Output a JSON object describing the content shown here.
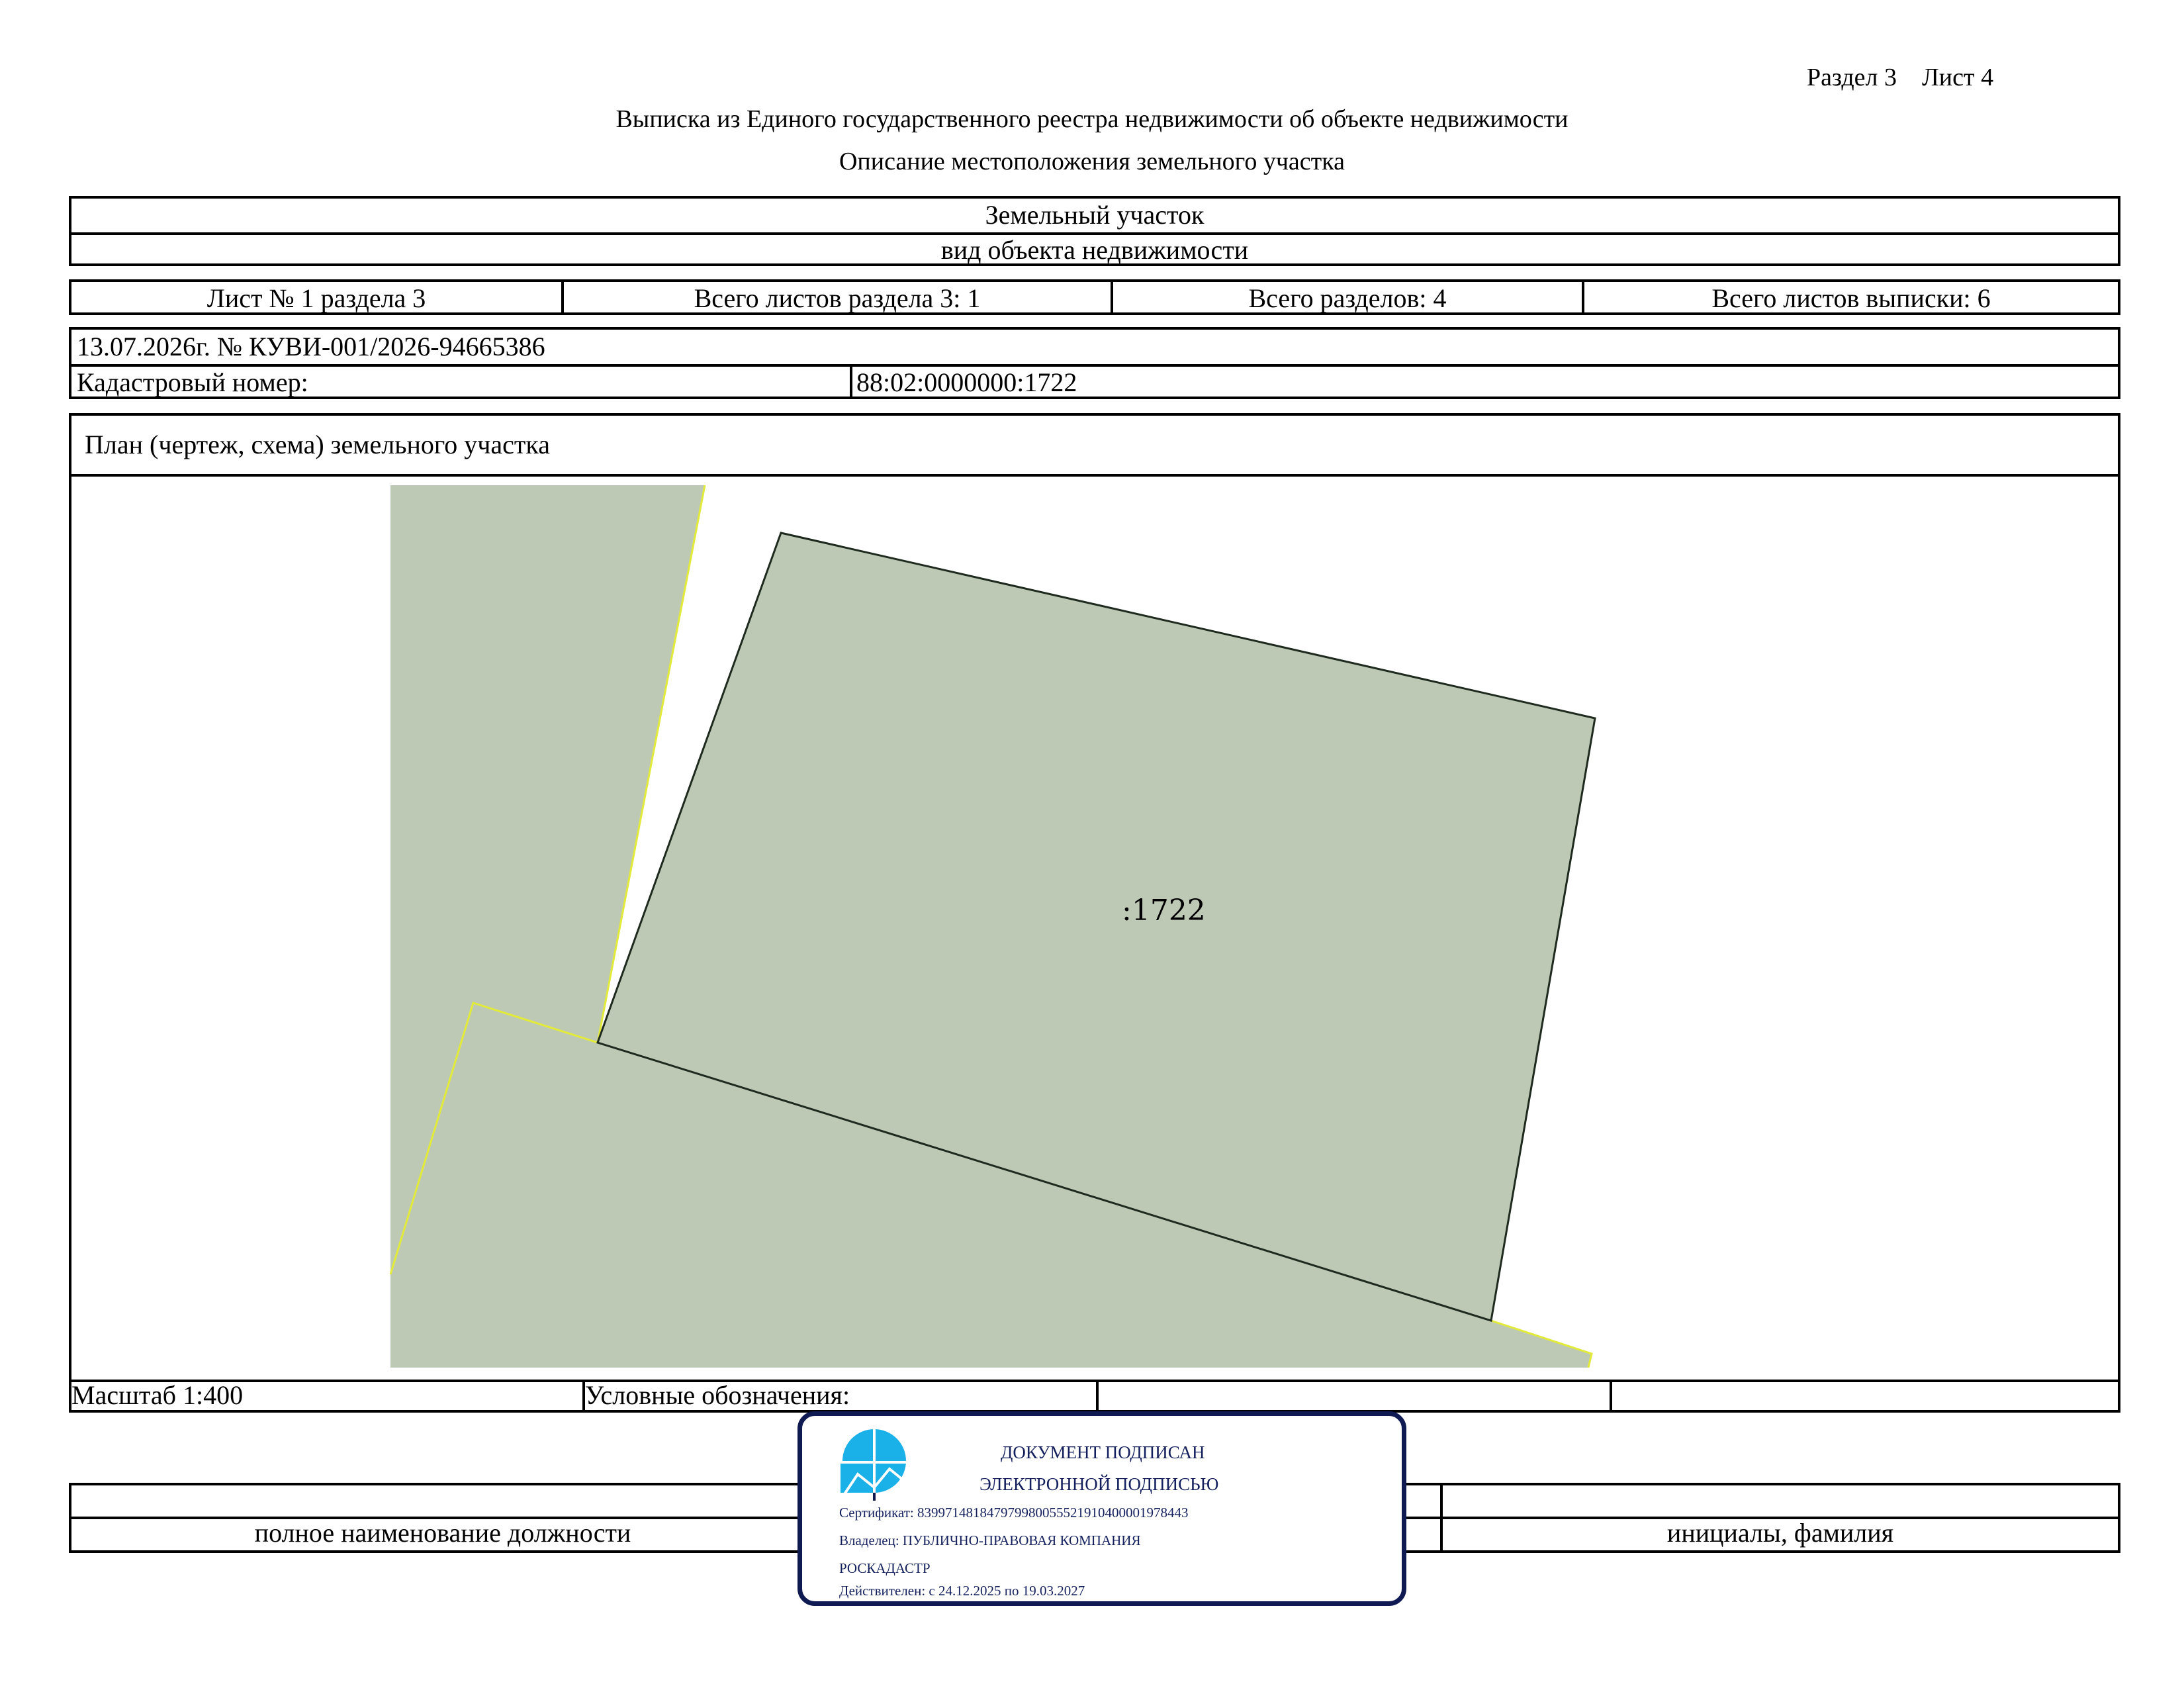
{
  "header": {
    "section_sheet": "Раздел 3    Лист 4",
    "title": "Выписка из Единого государственного реестра недвижимости об объекте недвижимости",
    "subtitle": "Описание местоположения земельного участка"
  },
  "object": {
    "name": "Земельный участок",
    "kind_caption": "вид объекта недвижимости"
  },
  "sheets": {
    "sheet_no": "Лист № 1 раздела 3",
    "section_sheets": "Всего листов раздела 3: 1",
    "sections_total": "Всего разделов: 4",
    "extract_sheets": "Всего листов выписки: 6"
  },
  "record": {
    "date_number": "13.07.2026г. № КУВИ-001/2026-94665386",
    "cadastral_label": "Кадастровый номер:",
    "cadastral_value": "88:02:0000000:1722"
  },
  "plan": {
    "title": "План (чертеж, схема) земельного участка",
    "parcel_label": ":1722",
    "fill_color": "#bdc9b5",
    "neighbor_border_color": "#e2ea3a"
  },
  "legend": {
    "scale": "Масштаб 1:400",
    "legend_label": "Условные обозначения:"
  },
  "signature": {
    "position_caption": "полное наименование должности",
    "name_caption": "инициалы, фамилия"
  },
  "stamp": {
    "line1": "ДОКУМЕНТ ПОДПИСАН",
    "line2": "ЭЛЕКТРОННОЙ ПОДПИСЬЮ",
    "certificate": "Сертификат: 839971481847979980055521910400001978443",
    "owner": "Владелец: ПУБЛИЧНО-ПРАВОВАЯ КОМПАНИЯ",
    "owner2": "РОСКАДАСТР",
    "valid": "Действителен: с 24.12.2025 по 19.03.2027",
    "frame_color": "#0f1a52",
    "logo_color": "#1ab0e8"
  }
}
